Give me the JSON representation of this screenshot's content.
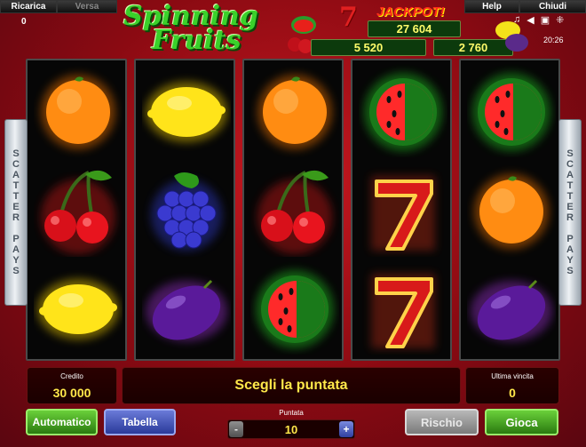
{
  "topbar": {
    "ricarica": "Ricarica",
    "versa": "Versa",
    "help": "Help",
    "chiudi": "Chiudi",
    "balance": "0",
    "clock": "20:26"
  },
  "logo": {
    "line1": "Spinning",
    "line2": "Fruits"
  },
  "jackpot": {
    "title": "JACKPOT!",
    "seven": "7",
    "main": "27 604",
    "left": "5 520",
    "right": "2 760"
  },
  "scatter": {
    "left": [
      "S",
      "C",
      "A",
      "T",
      "T",
      "E",
      "R",
      " ",
      "P",
      "A",
      "Y",
      "S"
    ],
    "right": [
      "S",
      "C",
      "A",
      "T",
      "T",
      "E",
      "R",
      " ",
      "P",
      "A",
      "Y",
      "S"
    ]
  },
  "reels": [
    [
      "orange",
      "cherry",
      "lemon"
    ],
    [
      "lemon",
      "grape",
      "plum"
    ],
    [
      "orange",
      "cherry",
      "watermelon"
    ],
    [
      "watermelon",
      "seven",
      "seven"
    ],
    [
      "watermelon",
      "orange",
      "plum"
    ]
  ],
  "bottom": {
    "credit_label": "Credito",
    "credit_value": "30 000",
    "message": "Scegli la puntata",
    "lastwin_label": "Ultima vincita",
    "lastwin_value": "0",
    "bet_label": "Puntata",
    "bet_value": "10",
    "btn_auto": "Automatico",
    "btn_tab": "Tabella",
    "btn_rischio": "Rischio",
    "btn_gioca": "Gioca",
    "minus": "-",
    "plus": "+"
  }
}
